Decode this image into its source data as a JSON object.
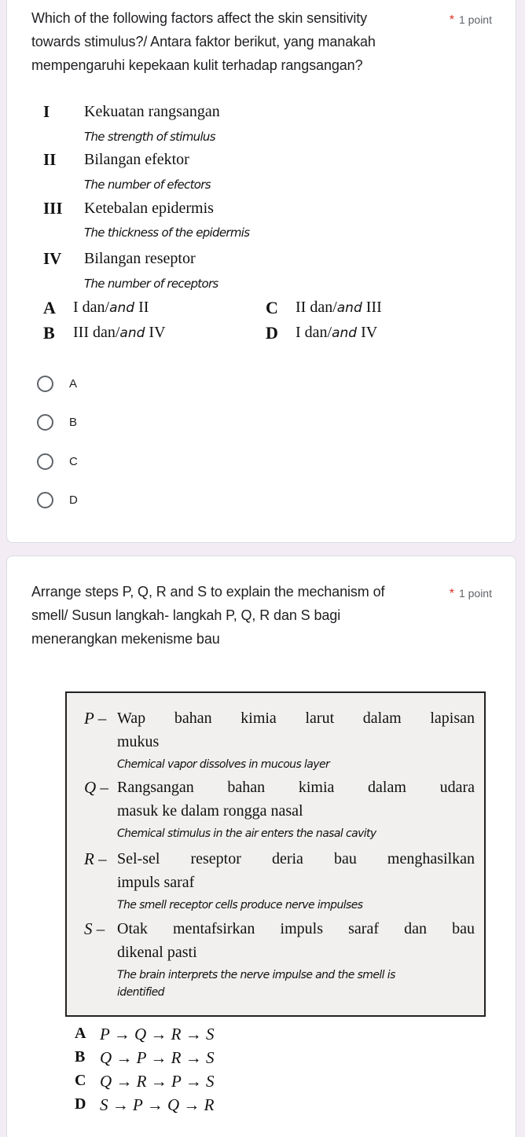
{
  "questions": [
    {
      "title": "Which of the following factors affect the skin sensitivity towards stimulus?/ Antara faktor berikut, yang manakah mempengaruhi kepekaan kulit terhadap rangsangan?",
      "title_lines": [
        "Which of the following factors affect the skin sensitivity",
        "towards stimulus?/ Antara faktor berikut, yang manakah",
        "mempengaruhi kepekaan kulit terhadap rangsangan?"
      ],
      "required_mark": "*",
      "points": "1 point",
      "image": {
        "statements": [
          {
            "numeral": "I",
            "malay": "Kekuatan rangsangan",
            "english": "The strength of stimulus"
          },
          {
            "numeral": "II",
            "malay": "Bilangan efektor",
            "english": "The number of efectors"
          },
          {
            "numeral": "III",
            "malay": "Ketebalan epidermis",
            "english": "The thickness of the epidermis"
          },
          {
            "numeral": "IV",
            "malay": "Bilangan reseptor",
            "english": "The number of receptors"
          }
        ],
        "options": [
          {
            "letter": "A",
            "first": "I dan/",
            "and": "and",
            "last": " II"
          },
          {
            "letter": "B",
            "first": "III dan/",
            "and": "and",
            "last": " IV"
          },
          {
            "letter": "C",
            "first": "II dan/",
            "and": "and",
            "last": " III"
          },
          {
            "letter": "D",
            "first": "I dan/",
            "and": "and",
            "last": " IV"
          }
        ]
      },
      "choices": [
        "A",
        "B",
        "C",
        "D"
      ],
      "selected": null
    },
    {
      "title": "Arrange steps P, Q, R and S to explain the mechanism of smell/ Susun langkah- langkah P, Q, R dan S bagi menerangkan mekenisme bau",
      "title_lines": [
        "Arrange steps P, Q, R and S to explain the mechanism of",
        "smell/ Susun langkah- langkah P, Q, R dan S bagi",
        "menerangkan mekenisme bau"
      ],
      "required_mark": "*",
      "points": "1 point",
      "image": {
        "steps": [
          {
            "key": "P –",
            "malay_1": "Wap bahan kimia larut dalam lapisan",
            "malay_2": "mukus",
            "english_1": "Chemical vapor dissolves in mucous layer",
            "english_2": ""
          },
          {
            "key": "Q –",
            "malay_1": "Rangsangan bahan kimia dalam udara",
            "malay_2": "masuk ke dalam rongga nasal",
            "english_1": "Chemical stimulus in the air enters the nasal cavity",
            "english_2": ""
          },
          {
            "key": "R –",
            "malay_1": "Sel-sel reseptor deria bau menghasilkan",
            "malay_2": "impuls saraf",
            "english_1": "The smell receptor cells produce nerve impulses",
            "english_2": ""
          },
          {
            "key": "S –",
            "malay_1": "Otak mentafsirkan impuls saraf dan bau",
            "malay_2": "dikenal pasti",
            "english_1": "The brain interprets the nerve impulse and the smell is",
            "english_2": "identified"
          }
        ],
        "options": [
          {
            "letter": "A",
            "sequence": "P → Q → R → S"
          },
          {
            "letter": "B",
            "sequence": "Q → P → R → S"
          },
          {
            "letter": "C",
            "sequence": "Q → R → P → S"
          },
          {
            "letter": "D",
            "sequence": "S → P → Q → R"
          }
        ]
      }
    }
  ]
}
